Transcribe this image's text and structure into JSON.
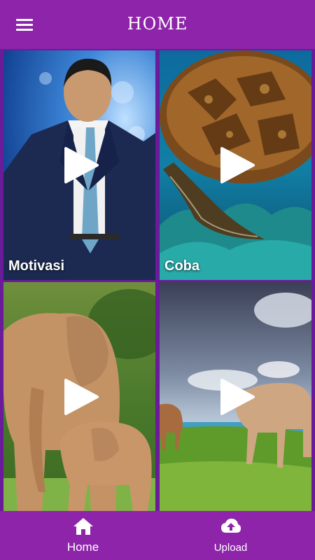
{
  "header": {
    "title": "HOME",
    "menu_icon": "hamburger-menu-icon"
  },
  "videos": [
    {
      "label": "Motivasi",
      "thumbnail": "man-in-suit-photo",
      "icon": "play-icon"
    },
    {
      "label": "Coba",
      "thumbnail": "sea-turtle-photo",
      "icon": "play-icon"
    },
    {
      "label": "",
      "thumbnail": "elephants-photo",
      "icon": "play-icon"
    },
    {
      "label": "",
      "thumbnail": "horses-on-grass-photo",
      "icon": "play-icon"
    }
  ],
  "bottom_nav": {
    "items": [
      {
        "label": "Home",
        "icon": "home-icon"
      },
      {
        "label": "Upload",
        "icon": "cloud-upload-icon"
      }
    ]
  },
  "colors": {
    "primary": "#8e24aa",
    "grid_background": "#6a1b9a",
    "text": "#ffffff"
  }
}
